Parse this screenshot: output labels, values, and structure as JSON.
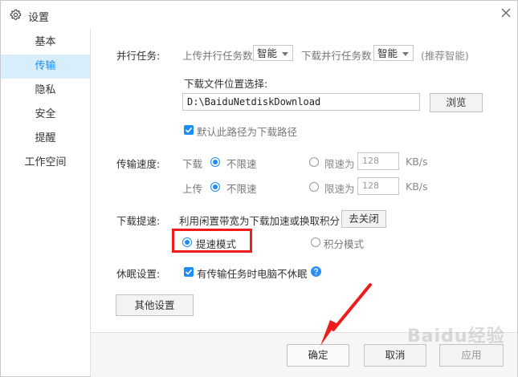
{
  "window": {
    "title": "设置"
  },
  "sidebar": {
    "items": [
      "基本",
      "传输",
      "隐私",
      "安全",
      "提醒",
      "工作空间"
    ],
    "active_index": 1
  },
  "parallel": {
    "label": "并行任务:",
    "upload_label": "上传并行任务数",
    "upload_value": "智能",
    "download_label": "下载并行任务数",
    "download_value": "智能",
    "hint": "(推荐智能)"
  },
  "location": {
    "label": "下载文件位置选择:",
    "path": "D:\\BaiduNetdiskDownload",
    "browse_label": "浏览",
    "default_label": "默认此路径为下载路径"
  },
  "speed": {
    "label": "传输速度:",
    "download_label": "下载",
    "upload_label": "上传",
    "unlimited_label": "不限速",
    "limit_label": "限速为",
    "download_limit_value": "128",
    "upload_limit_value": "128",
    "unit": "KB/s"
  },
  "boost": {
    "label": "下载提速:",
    "description": "利用闲置带宽为下载加速或换取积分",
    "toggle_label": "去关闭",
    "mode_speed_label": "提速模式",
    "mode_points_label": "积分模式"
  },
  "sleep": {
    "label": "休眠设置:",
    "checkbox_label": "有传输任务时电脑不休眠"
  },
  "other_settings_label": "其他设置",
  "footer": {
    "ok_label": "确定",
    "cancel_label": "取消",
    "apply_label": "应用"
  },
  "watermark": "Baidu经验",
  "colors": {
    "accent": "#1c8df2",
    "highlight": "#ee1c1c"
  }
}
